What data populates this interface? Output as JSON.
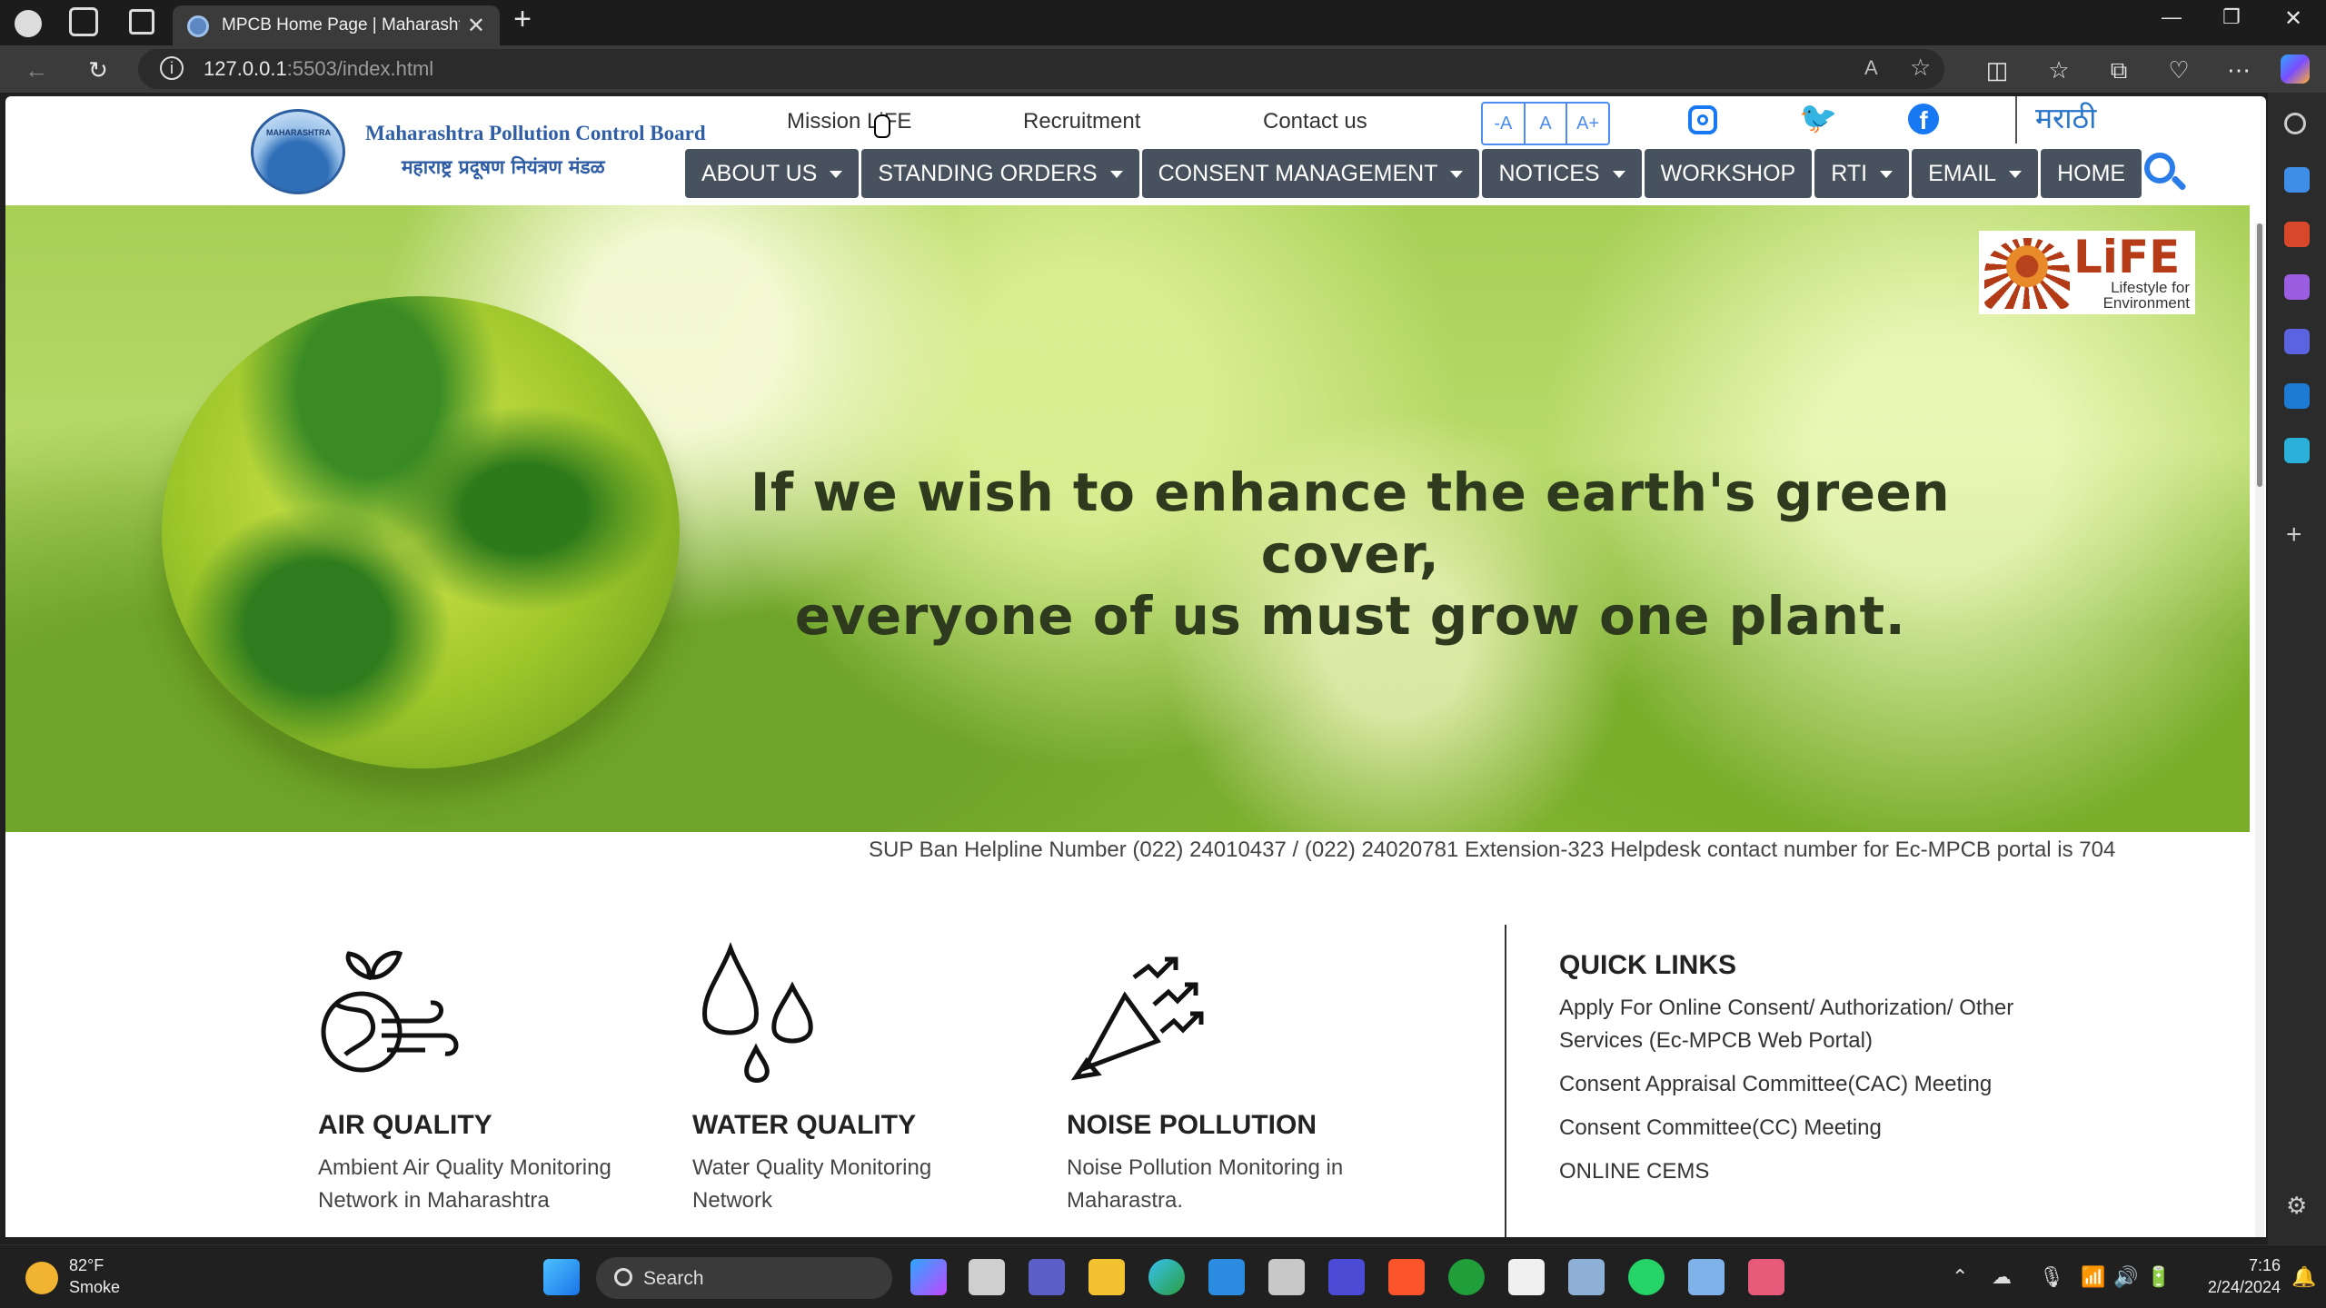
{
  "browser": {
    "tab_title": "MPCB Home Page | Maharashtra Pollution Control Board",
    "url_host": "127.0.0.1",
    "url_rest": ":5503/index.html",
    "new_tab_symbol": "+",
    "close_symbol": "✕",
    "window_controls": [
      "—",
      "❐",
      "✕"
    ]
  },
  "site": {
    "logo_text_en": "Maharashtra Pollution Control Board",
    "logo_text_mr": "महाराष्ट्र प्रदूषण नियंत्रण मंडळ",
    "logo_globe_text": "MAHARASHTRA",
    "top_links": [
      "Mission LiFE",
      "Recruitment",
      "Contact us"
    ],
    "font_controls": [
      "-A",
      "A",
      "A+"
    ],
    "language_link": "मराठी",
    "social_icons": [
      "instagram-icon",
      "twitter-icon",
      "facebook-icon"
    ],
    "nav": [
      {
        "label": "ABOUT US",
        "dropdown": true
      },
      {
        "label": "STANDING ORDERS",
        "dropdown": true
      },
      {
        "label": "CONSENT MANAGEMENT",
        "dropdown": true
      },
      {
        "label": "NOTICES",
        "dropdown": true
      },
      {
        "label": "WORKSHOP",
        "dropdown": false
      },
      {
        "label": "RTI",
        "dropdown": true
      },
      {
        "label": "EMAIL",
        "dropdown": true
      },
      {
        "label": "HOME",
        "dropdown": false
      }
    ]
  },
  "banner": {
    "quote_line1": "If we wish to enhance the earth's green cover,",
    "quote_line2": "everyone of us must grow one plant.",
    "life_logo_big": "LiFE",
    "life_logo_small1": "Lifestyle for",
    "life_logo_small2": "Environment"
  },
  "ticker": "SUP Ban Helpline Number (022) 24010437 / (022) 24020781 Extension-323 Helpdesk contact number for Ec-MPCB portal is 704",
  "cards": [
    {
      "icon": "air-quality-icon",
      "title": "AIR QUALITY",
      "desc": "Ambient Air Quality Monitoring Network in Maharashtra"
    },
    {
      "icon": "water-drops-icon",
      "title": "WATER QUALITY",
      "desc": "Water Quality Monitoring Network"
    },
    {
      "icon": "megaphone-icon",
      "title": "NOISE POLLUTION",
      "desc": "Noise Pollution Monitoring in Maharastra."
    }
  ],
  "quick_links": {
    "heading": "QUICK LINKS",
    "items": [
      "Apply For Online Consent/ Authorization/ Other Services (Ec-MPCB Web Portal)",
      "Consent Appraisal Committee(CAC) Meeting",
      "Consent Committee(CC) Meeting",
      "ONLINE CEMS"
    ]
  },
  "taskbar": {
    "temperature": "82°F",
    "weather": "Smoke",
    "search_label": "Search",
    "time": "7:16",
    "date": "2/24/2024"
  },
  "colors": {
    "nav_bg": "#47525e",
    "accent_blue": "#2a7ce8",
    "banner_green": "#a7cf55"
  }
}
